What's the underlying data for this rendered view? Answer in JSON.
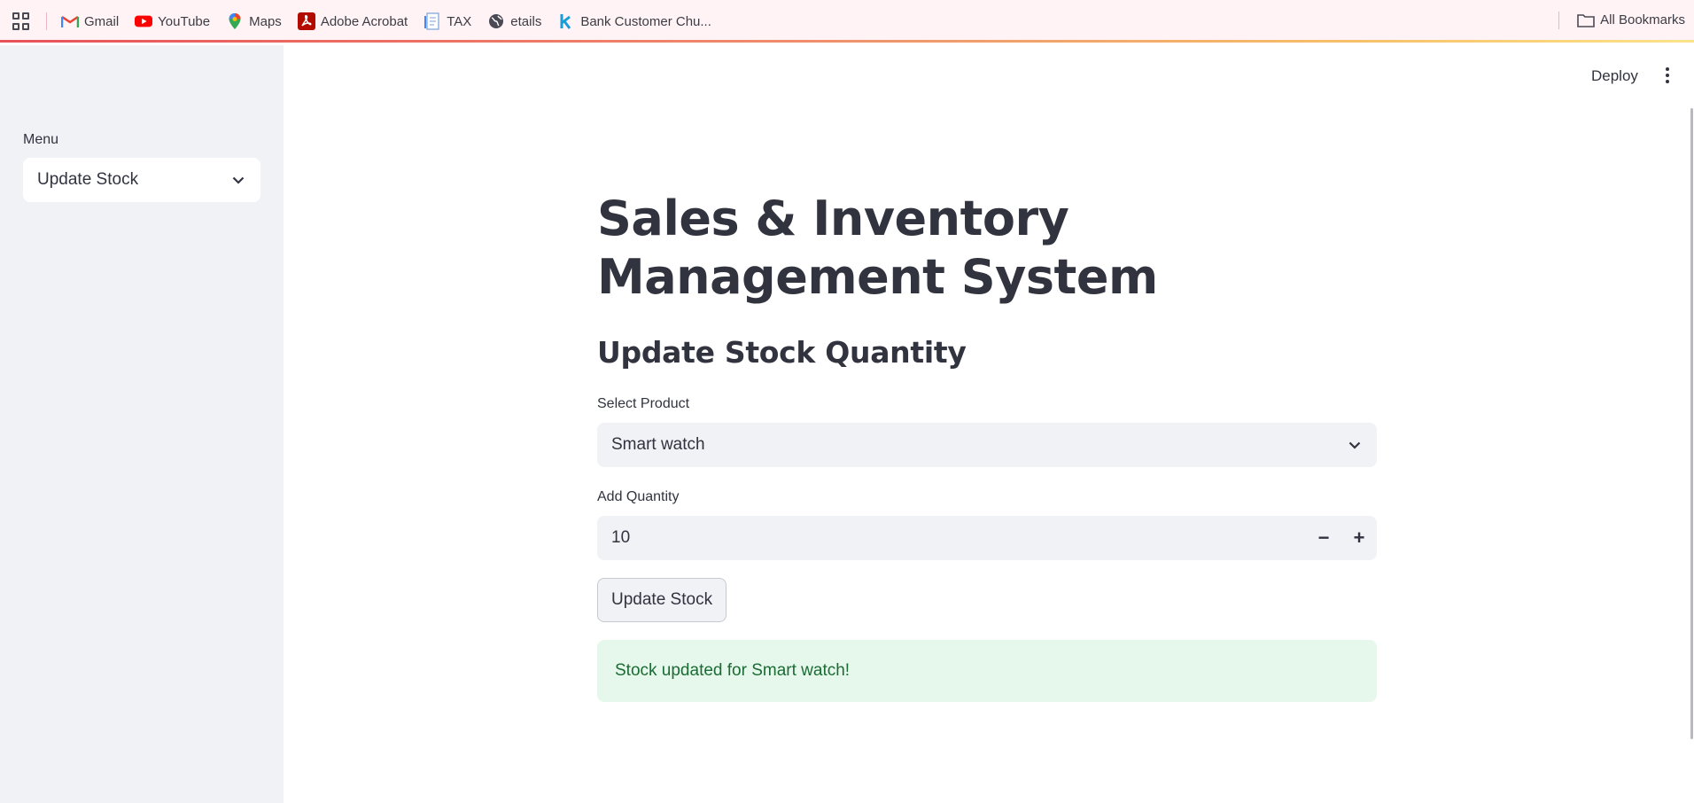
{
  "bookmarks": {
    "items": [
      {
        "label": "Gmail",
        "icon": "gmail-icon"
      },
      {
        "label": "YouTube",
        "icon": "youtube-icon"
      },
      {
        "label": "Maps",
        "icon": "maps-icon"
      },
      {
        "label": "Adobe Acrobat",
        "icon": "acrobat-icon"
      },
      {
        "label": "TAX",
        "icon": "document-icon"
      },
      {
        "label": "etails",
        "icon": "globe-icon"
      },
      {
        "label": "Bank Customer Chu...",
        "icon": "k-icon"
      }
    ],
    "all_bookmarks": "All Bookmarks"
  },
  "sidebar": {
    "menu_label": "Menu",
    "menu_selected": "Update Stock"
  },
  "header": {
    "deploy": "Deploy"
  },
  "main": {
    "title": "Sales & Inventory Management System",
    "section": "Update Stock Quantity",
    "product_label": "Select Product",
    "product_value": "Smart watch",
    "quantity_label": "Add Quantity",
    "quantity_value": "10",
    "decrement": "−",
    "increment": "+",
    "submit": "Update Stock",
    "success_message": "Stock updated for Smart watch!"
  },
  "colors": {
    "sidebar_bg": "#f0f2f6",
    "text": "#31333f",
    "success_bg": "#e6f8ec",
    "success_text": "#1b6b34"
  }
}
